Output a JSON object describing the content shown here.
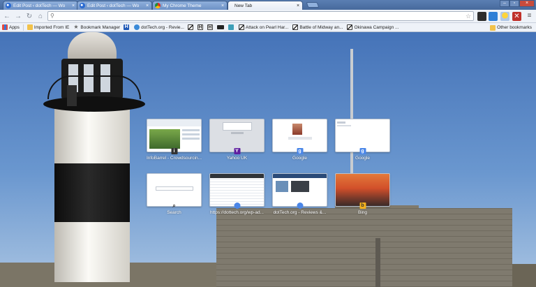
{
  "tabs": [
    {
      "title": "Edit Post ‹ dotTech — Wo",
      "icon": "wordpress-icon",
      "active": false
    },
    {
      "title": "Edit Post ‹ dotTech — Wo",
      "icon": "wordpress-icon",
      "active": false
    },
    {
      "title": "My Chrome Theme",
      "icon": "chrome-icon",
      "active": false
    },
    {
      "title": "New Tab",
      "icon": "",
      "active": true
    }
  ],
  "omnibox": {
    "value": "",
    "placeholder": ""
  },
  "bookmarks": {
    "apps_label": "Apps",
    "items": [
      {
        "label": "Imported From IE",
        "icon": "folder-icon"
      },
      {
        "label": "Bookmark Manager",
        "icon": "star-icon"
      },
      {
        "label": "",
        "icon": "blue-h-icon"
      },
      {
        "label": "dotTech.org - Revie...",
        "icon": "dottech-icon"
      },
      {
        "label": "",
        "icon": "flag-icon"
      },
      {
        "label": "",
        "icon": "h-icon"
      },
      {
        "label": "",
        "icon": "h-icon"
      },
      {
        "label": "",
        "icon": "dark-icon"
      },
      {
        "label": "",
        "icon": "globe-icon"
      },
      {
        "label": "Attack on Pearl Har...",
        "icon": "flag-icon"
      },
      {
        "label": "Battle of Midway an...",
        "icon": "flag-icon"
      },
      {
        "label": "Okinawa Campaign ...",
        "icon": "flag-icon"
      }
    ],
    "other_label": "Other bookmarks"
  },
  "tiles": [
    {
      "label": "InfoBarrel - Crowdsourcin...",
      "favicon": "infobarrel-icon",
      "fav_color": "#333333",
      "fav_text": "i"
    },
    {
      "label": "Yahoo UK",
      "favicon": "yahoo-icon",
      "fav_color": "#5f1fa0",
      "fav_text": "Y"
    },
    {
      "label": "Google",
      "favicon": "google-icon",
      "fav_color": "#4a86e8",
      "fav_text": "g"
    },
    {
      "label": "Google",
      "favicon": "google-icon",
      "fav_color": "#4a86e8",
      "fav_text": "g"
    },
    {
      "label": "Search",
      "favicon": "search-icon",
      "fav_color": "#ffffff",
      "fav_text": "⌕"
    },
    {
      "label": "https://dottech.org/wp-ad...",
      "favicon": "globe-icon",
      "fav_color": "#4a86e8",
      "fav_text": ""
    },
    {
      "label": "dotTech.org - Reviews &...",
      "favicon": "globe-icon",
      "fav_color": "#4a86e8",
      "fav_text": ""
    },
    {
      "label": "Bing",
      "favicon": "bing-icon",
      "fav_color": "#f2b01e",
      "fav_text": "b"
    }
  ]
}
